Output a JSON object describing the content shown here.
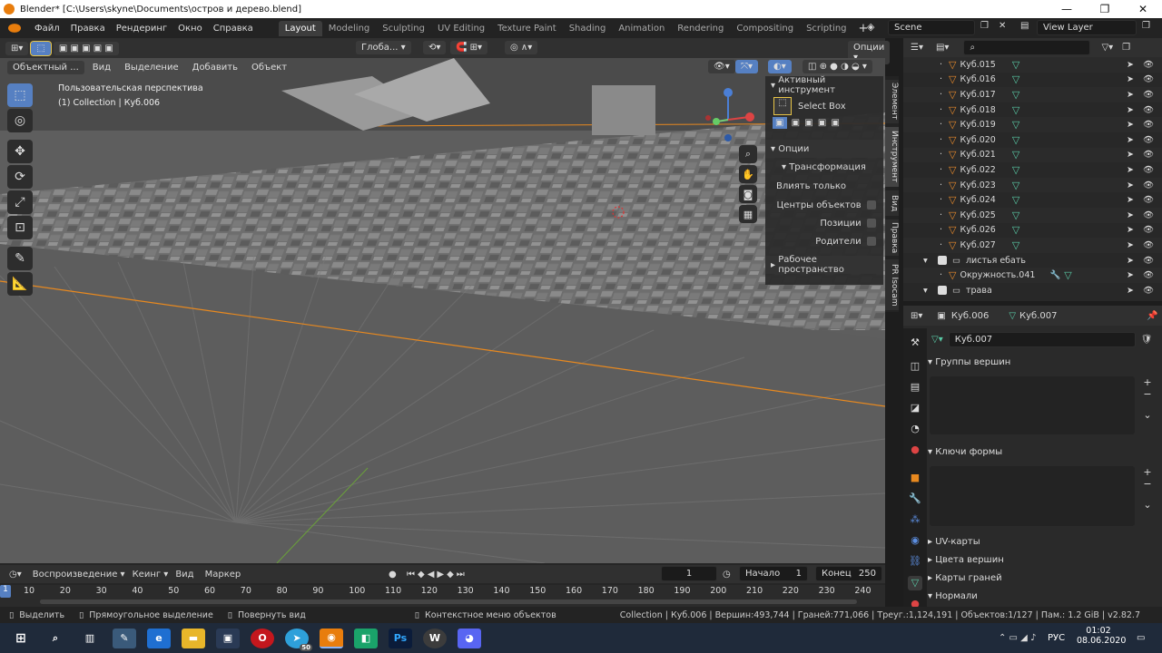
{
  "title": "Blender* [C:\\Users\\skyne\\Documents\\остров и дерево.blend]",
  "menu": [
    "Файл",
    "Правка",
    "Рендеринг",
    "Окно",
    "Справка"
  ],
  "workspaces": [
    "Layout",
    "Modeling",
    "Sculpting",
    "UV Editing",
    "Texture Paint",
    "Shading",
    "Animation",
    "Rendering",
    "Compositing",
    "Scripting"
  ],
  "scene": "Scene",
  "view_layer": "View Layer",
  "viewport_header": {
    "transform_orientation": "Глоба...",
    "options": "Опции"
  },
  "viewport_header2": {
    "mode": "Объектный ...",
    "view": "Вид",
    "select": "Выделение",
    "add": "Добавить",
    "object": "Объект"
  },
  "viewport_info": {
    "perspective": "Пользовательская перспектива",
    "collection": "(1) Collection | Куб.006"
  },
  "npanel": {
    "active_tool": "Активный инструмент",
    "tool_name": "Select Box",
    "options": "Опции",
    "transform": "Трансформация",
    "affect_only": "Влиять только",
    "origins": "Центры объектов",
    "locations": "Позиции",
    "parents": "Родители",
    "workspace": "Рабочее пространство"
  },
  "ntabs": [
    "Элемент",
    "Инструмент",
    "Вид",
    "Правка",
    "PR Isocam"
  ],
  "outliner": {
    "items": [
      "Куб.015",
      "Куб.016",
      "Куб.017",
      "Куб.018",
      "Куб.019",
      "Куб.020",
      "Куб.021",
      "Куб.022",
      "Куб.023",
      "Куб.024",
      "Куб.025",
      "Куб.026",
      "Куб.027"
    ],
    "collection1": "листья ебать",
    "child": "Окружность.041",
    "collection2": "трава"
  },
  "properties": {
    "obj1": "Куб.006",
    "obj2": "Куб.007",
    "mesh": "Куб.007",
    "vertex_groups": "Группы вершин",
    "shape_keys": "Ключи формы",
    "uv_maps": "UV-карты",
    "vertex_colors": "Цвета вершин",
    "face_maps": "Карты граней",
    "normals": "Нормали"
  },
  "timeline": {
    "playback": "Воспроизведение",
    "keying": "Кеинг",
    "view": "Вид",
    "marker": "Маркер",
    "current_frame": "1",
    "start_label": "Начало",
    "start": "1",
    "end_label": "Конец",
    "end": "250",
    "ticks": [
      "10",
      "20",
      "30",
      "40",
      "50",
      "60",
      "70",
      "80",
      "90",
      "100",
      "110",
      "120",
      "130",
      "140",
      "150",
      "160",
      "170",
      "180",
      "190",
      "200",
      "210",
      "220",
      "230",
      "240"
    ],
    "frame_marker": "1"
  },
  "statusbar": {
    "select": "Выделить",
    "box_select": "Прямоугольное выделение",
    "rotate_view": "Повернуть вид",
    "context_menu": "Контекстное меню объектов",
    "stats": "Collection | Куб.006 | Вершин:493,744 | Граней:771,066 | Треуг.:1,124,191 | Объектов:1/127 | Пам.: 1.2 GiB | v2.82.7"
  },
  "taskbar": {
    "lang": "РУС",
    "time": "01:02",
    "date": "08.06.2020",
    "badge": "50"
  },
  "colors": {
    "accent": "#5680c2",
    "orange": "#e87d0d",
    "vertex": "#59c9a5"
  }
}
